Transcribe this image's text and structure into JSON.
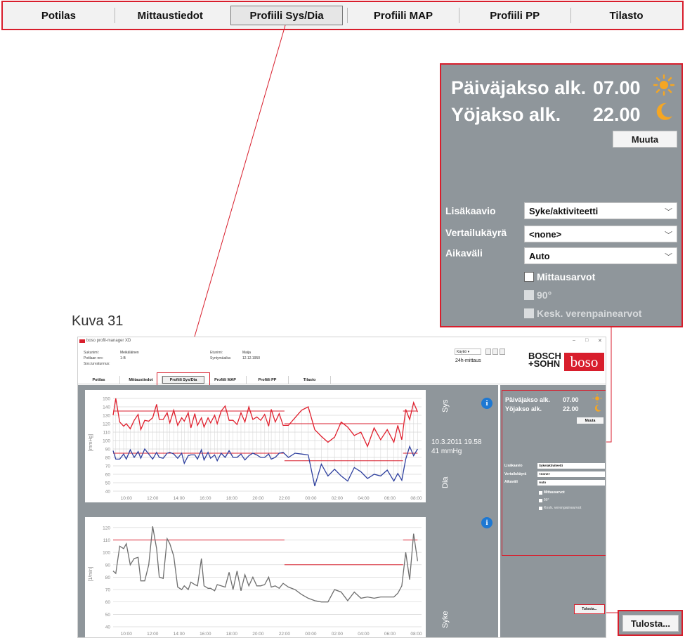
{
  "tabs": [
    "Potilas",
    "Mittaustiedot",
    "Profiili Sys/Dia",
    "Profiili MAP",
    "Profiili PP",
    "Tilasto"
  ],
  "active_tab": "Profiili Sys/Dia",
  "caption": "Kuva 31",
  "settings": {
    "day_label": "Päiväjakso alk.",
    "day_time": "07.00",
    "night_label": "Yöjakso alk.",
    "night_time": "22.00",
    "change_button": "Muuta",
    "extra_chart_label": "Lisäkaavio",
    "extra_chart_value": "Syke/aktiviteetti",
    "compare_label": "Vertailukäyrä",
    "compare_value": "<none>",
    "interval_label": "Aikaväli",
    "interval_value": "Auto",
    "check_values": "Mittausarvot",
    "check_90": "90°",
    "check_mean": "Kesk. verenpainearvot",
    "print_button": "Tulosta..."
  },
  "app": {
    "title": "boso profil-manager XD",
    "surname_label": "Sukunimi:",
    "surname": "Meikäläinen",
    "patient_no_label": "Potilaan nro:",
    "patient_no": "1-B",
    "ssn_label": "Sos.turvatunnus:",
    "firstname_label": "Etunimi:",
    "firstname": "Maija",
    "birthdate_label": "Syntymäaika:",
    "birthdate": "12.12.1950",
    "user_select": "Käyttö",
    "mode": "24h-mittaus",
    "brand_line1": "BOSCH",
    "brand_line2": "+SOHN",
    "brand_logo": "boso",
    "window_min": "–",
    "window_max": "□",
    "window_close": "✕",
    "sys_label": "Sys",
    "dia_label": "Dia",
    "syke_label": "Syke",
    "readout_time": "10.3.2011 19.58",
    "readout_value": "41 mmHg",
    "info_glyph": "i"
  },
  "colors": {
    "accent": "#d81e2c",
    "panel_bg": "#8f969b",
    "sys_line": "#e0202e",
    "dia_line": "#2d3f9e",
    "hr_line": "#6e6e6e",
    "info": "#1e78d2",
    "sun": "#f5a623",
    "moon": "#f5a623"
  },
  "icons": {
    "day": "sun-icon",
    "night": "moon-icon",
    "info": "info-icon",
    "dropdown": "chevron-down-icon"
  },
  "chart_data": [
    {
      "type": "line",
      "ylabel": "[mmHg]",
      "ylim": [
        40,
        155
      ],
      "yticks": [
        40,
        50,
        60,
        70,
        80,
        90,
        100,
        110,
        120,
        130,
        140,
        150
      ],
      "x_ticks": [
        "10:00",
        "12:00",
        "14:00",
        "16:00",
        "18:00",
        "20:00",
        "22:00",
        "00:00",
        "02:00",
        "04:00",
        "06:00",
        "08:00"
      ],
      "series": [
        {
          "key": "sys",
          "x": [
            9.0,
            9.2,
            9.5,
            9.8,
            10.0,
            10.3,
            10.6,
            10.9,
            11.1,
            11.4,
            11.7,
            12.0,
            12.3,
            12.5,
            12.8,
            13.1,
            13.3,
            13.6,
            13.9,
            14.2,
            14.4,
            14.7,
            14.9,
            15.2,
            15.4,
            15.7,
            15.9,
            16.2,
            16.4,
            16.7,
            16.9,
            17.2,
            17.5,
            17.8,
            18.1,
            18.4,
            18.7,
            19.0,
            19.3,
            19.6,
            19.9,
            20.2,
            20.5,
            20.8,
            21.0,
            21.3,
            21.6,
            21.9,
            22.3,
            22.8,
            23.3,
            23.8,
            24.3,
            24.8,
            25.3,
            25.8,
            26.3,
            26.8,
            27.3,
            27.8,
            28.3,
            28.8,
            29.3,
            29.8,
            30.3,
            30.6,
            30.9,
            31.2,
            31.5,
            31.8,
            32.1
          ],
          "values": [
            130,
            150,
            122,
            117,
            120,
            114,
            124,
            131,
            113,
            124,
            123,
            127,
            143,
            125,
            125,
            133,
            121,
            136,
            118,
            127,
            123,
            133,
            115,
            132,
            118,
            127,
            116,
            127,
            121,
            130,
            120,
            135,
            141,
            124,
            124,
            119,
            133,
            122,
            140,
            125,
            128,
            124,
            131,
            117,
            137,
            122,
            132,
            118,
            118,
            127,
            136,
            140,
            113,
            105,
            98,
            104,
            122,
            116,
            106,
            110,
            93,
            115,
            101,
            113,
            98,
            118,
            101,
            137,
            125,
            145,
            134
          ],
          "ref_levels": [
            {
              "x0": 9.0,
              "x1": 22.0,
              "y": 135
            },
            {
              "x0": 22.0,
              "x1": 31.0,
              "y": 120
            },
            {
              "x0": 31.0,
              "x1": 32.1,
              "y": 135
            }
          ]
        },
        {
          "key": "dia",
          "x": [
            9.0,
            9.2,
            9.5,
            9.8,
            10.0,
            10.3,
            10.6,
            10.9,
            11.1,
            11.4,
            11.7,
            12.0,
            12.3,
            12.5,
            12.8,
            13.1,
            13.3,
            13.6,
            13.9,
            14.2,
            14.4,
            14.7,
            14.9,
            15.2,
            15.4,
            15.7,
            15.9,
            16.2,
            16.4,
            16.7,
            16.9,
            17.2,
            17.5,
            17.8,
            18.1,
            18.4,
            18.7,
            19.0,
            19.3,
            19.6,
            19.9,
            20.2,
            20.5,
            20.8,
            21.0,
            21.3,
            21.6,
            21.9,
            22.3,
            22.8,
            23.3,
            23.8,
            24.3,
            24.8,
            25.3,
            25.8,
            26.3,
            26.8,
            27.3,
            27.8,
            28.3,
            28.8,
            29.3,
            29.8,
            30.3,
            30.6,
            30.9,
            31.2,
            31.5,
            31.8,
            32.1
          ],
          "values": [
            88,
            78,
            78,
            84,
            78,
            89,
            80,
            87,
            79,
            90,
            84,
            78,
            86,
            80,
            79,
            85,
            86,
            84,
            79,
            85,
            73,
            82,
            83,
            83,
            78,
            89,
            77,
            86,
            79,
            83,
            76,
            85,
            80,
            88,
            80,
            80,
            84,
            77,
            82,
            85,
            83,
            80,
            80,
            84,
            78,
            80,
            85,
            86,
            80,
            85,
            84,
            83,
            46,
            72,
            58,
            66,
            58,
            52,
            68,
            63,
            55,
            60,
            58,
            65,
            52,
            61,
            53,
            78,
            93,
            82,
            90
          ],
          "ref_levels": [
            {
              "x0": 9.0,
              "x1": 22.0,
              "y": 85
            },
            {
              "x0": 22.0,
              "x1": 31.0,
              "y": 76
            },
            {
              "x0": 31.0,
              "x1": 32.1,
              "y": 85
            }
          ]
        }
      ]
    },
    {
      "type": "line",
      "ylabel": "[1/min]",
      "ylim": [
        40,
        125
      ],
      "yticks": [
        40,
        50,
        60,
        70,
        80,
        90,
        100,
        110,
        120
      ],
      "x_ticks": [
        "10:00",
        "12:00",
        "14:00",
        "16:00",
        "18:00",
        "20:00",
        "22:00",
        "00:00",
        "02:00",
        "04:00",
        "06:00",
        "08:00"
      ],
      "series": [
        {
          "key": "hr",
          "x": [
            9.0,
            9.2,
            9.5,
            9.8,
            10.0,
            10.3,
            10.6,
            10.9,
            11.1,
            11.4,
            11.7,
            12.0,
            12.3,
            12.5,
            12.8,
            13.1,
            13.3,
            13.6,
            13.9,
            14.2,
            14.4,
            14.7,
            14.9,
            15.2,
            15.4,
            15.7,
            15.9,
            16.2,
            16.4,
            16.7,
            16.9,
            17.2,
            17.5,
            17.8,
            18.1,
            18.4,
            18.7,
            19.0,
            19.3,
            19.6,
            19.9,
            20.2,
            20.5,
            20.8,
            21.0,
            21.3,
            21.6,
            21.9,
            22.3,
            22.8,
            23.3,
            23.8,
            24.3,
            24.8,
            25.3,
            25.8,
            26.3,
            26.8,
            27.3,
            27.8,
            28.3,
            28.8,
            29.3,
            29.8,
            30.3,
            30.6,
            30.9,
            31.2,
            31.5,
            31.8,
            32.1
          ],
          "values": [
            85,
            83,
            105,
            103,
            107,
            90,
            95,
            96,
            77,
            77,
            90,
            121,
            103,
            80,
            79,
            111,
            107,
            97,
            72,
            70,
            73,
            70,
            76,
            74,
            73,
            95,
            73,
            71,
            71,
            69,
            74,
            73,
            72,
            84,
            70,
            85,
            69,
            82,
            73,
            80,
            73,
            73,
            74,
            80,
            72,
            73,
            71,
            75,
            72,
            70,
            66,
            63,
            61,
            60,
            60,
            70,
            68,
            61,
            68,
            63,
            64,
            63,
            64,
            64,
            64,
            67,
            73,
            100,
            78,
            115,
            93
          ],
          "ref_levels": [
            {
              "x0": 9.0,
              "x1": 22.0,
              "y": 110
            },
            {
              "x0": 22.0,
              "x1": 31.0,
              "y": 90
            },
            {
              "x0": 31.0,
              "x1": 32.1,
              "y": 110
            }
          ]
        }
      ]
    }
  ]
}
